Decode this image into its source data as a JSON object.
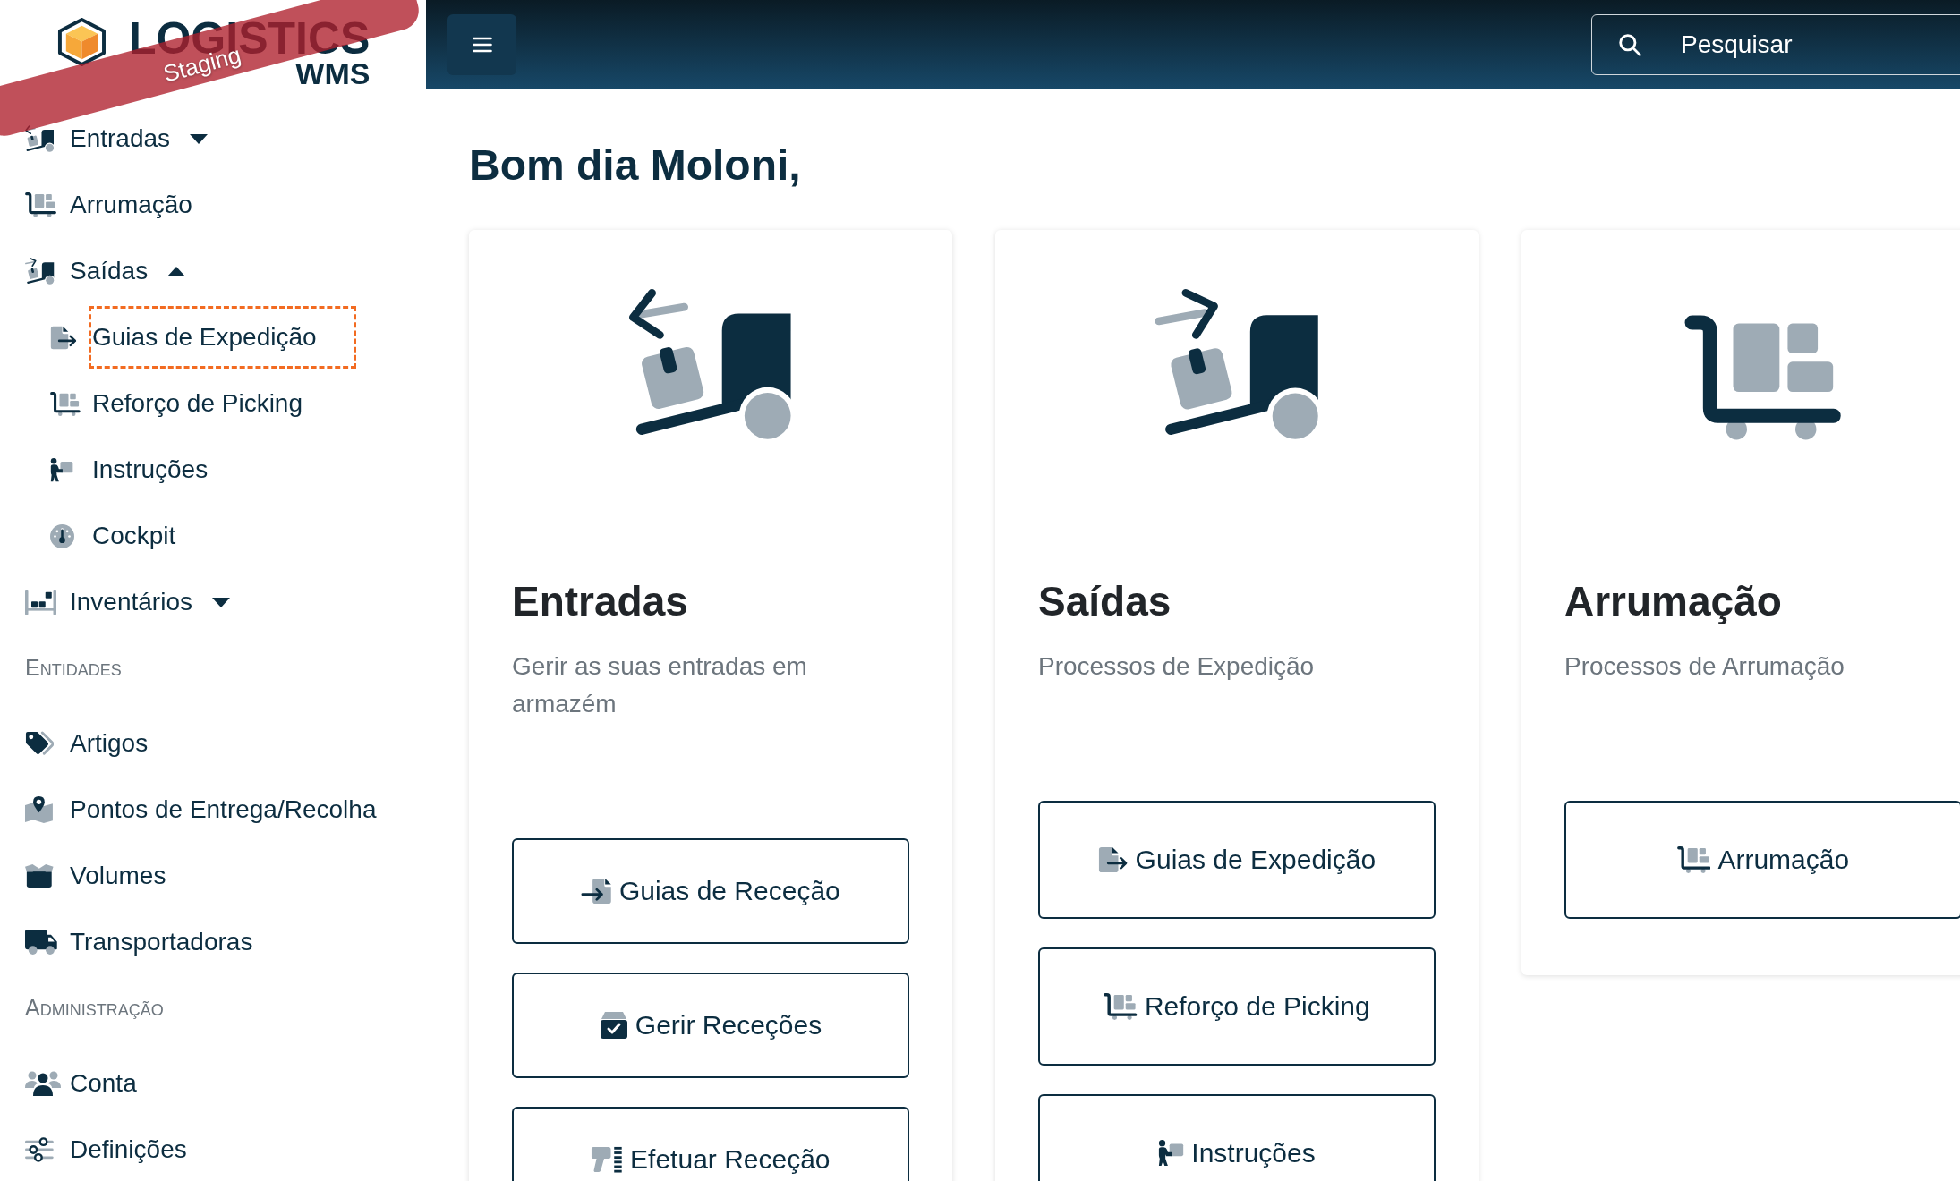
{
  "logo": {
    "title": "LOGISTICS",
    "subtitle": "WMS"
  },
  "ribbon": {
    "label": "Staging"
  },
  "header": {
    "search": {
      "placeholder": "Pesquisar"
    }
  },
  "sidebar": {
    "sections": [
      {
        "items": [
          {
            "label": "Entradas",
            "selected": false,
            "expanded": false
          },
          {
            "label": "Arrumação",
            "selected": false
          },
          {
            "label": "Saídas",
            "selected": false,
            "expanded": true,
            "children": [
              {
                "label": "Guias de Expedição",
                "selected": true
              },
              {
                "label": "Reforço de Picking",
                "selected": false
              },
              {
                "label": "Instruções",
                "selected": false
              },
              {
                "label": "Cockpit",
                "selected": false
              }
            ]
          },
          {
            "label": "Inventários",
            "selected": false,
            "expanded": false
          }
        ]
      },
      {
        "title": "Entidades",
        "items": [
          {
            "label": "Artigos",
            "selected": false
          },
          {
            "label": "Pontos de Entrega/Recolha",
            "selected": false
          },
          {
            "label": "Volumes",
            "selected": false
          },
          {
            "label": "Transportadoras",
            "selected": false
          }
        ]
      },
      {
        "title": "Administração",
        "items": [
          {
            "label": "Conta",
            "selected": false
          },
          {
            "label": "Definições",
            "selected": false
          }
        ]
      }
    ]
  },
  "greeting": "Bom dia Moloni,",
  "cards": [
    {
      "title": "Entradas",
      "description": "Gerir as suas entradas em armazém",
      "buttons": [
        "Guias de Receção",
        "Gerir Receções",
        "Efetuar Receção"
      ]
    },
    {
      "title": "Saídas",
      "description": "Processos de Expedição",
      "buttons": [
        "Guias de Expedição",
        "Reforço de Picking",
        "Instruções"
      ]
    },
    {
      "title": "Arrumação",
      "description": "Processos de Arrumação",
      "buttons": [
        "Arrumação"
      ]
    }
  ]
}
